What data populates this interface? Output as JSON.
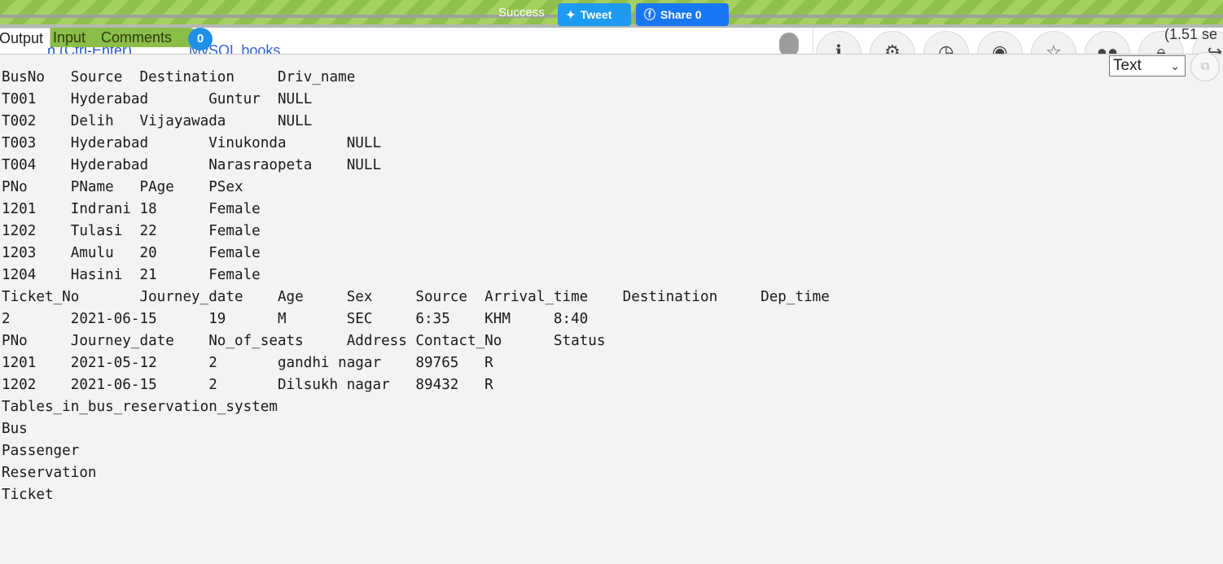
{
  "banner": {
    "success_text": "Success",
    "tweet_label": "Tweet",
    "share_label": "Share 0"
  },
  "tabs": {
    "output": "Output",
    "input": "Input",
    "comments": "Comments",
    "comments_count": "0"
  },
  "toolbar": {
    "run_hint": "n (Ctrl-Enter)",
    "mysql_link": "MySQL books",
    "exec_time": "(1.51 se",
    "icons": [
      "info-icon",
      "gear-icon",
      "clock-icon",
      "github-icon",
      "star-icon",
      "users-icon",
      "lock-icon",
      "share-icon"
    ]
  },
  "format_select": {
    "value": "Text"
  },
  "output_lines": [
    "BusNo   Source  Destination     Driv_name",
    "T001    Hyderabad       Guntur  NULL",
    "T002    Delih   Vijayawada      NULL",
    "T003    Hyderabad       Vinukonda       NULL",
    "T004    Hyderabad       Narasraopeta    NULL",
    "PNo     PName   PAge    PSex",
    "1201    Indrani 18      Female",
    "1202    Tulasi  22      Female",
    "1203    Amulu   20      Female",
    "1204    Hasini  21      Female",
    "Ticket_No       Journey_date    Age     Sex     Source  Arrival_time    Destination     Dep_time",
    "2       2021-06-15      19      M       SEC     6:35    KHM     8:40",
    "PNo     Journey_date    No_of_seats     Address Contact_No      Status",
    "1201    2021-05-12      2       gandhi nagar    89765   R",
    "1202    2021-06-15      2       Dilsukh nagar   89432   R",
    "Tables_in_bus_reservation_system",
    "Bus",
    "Passenger",
    "Reservation",
    "Ticket"
  ]
}
